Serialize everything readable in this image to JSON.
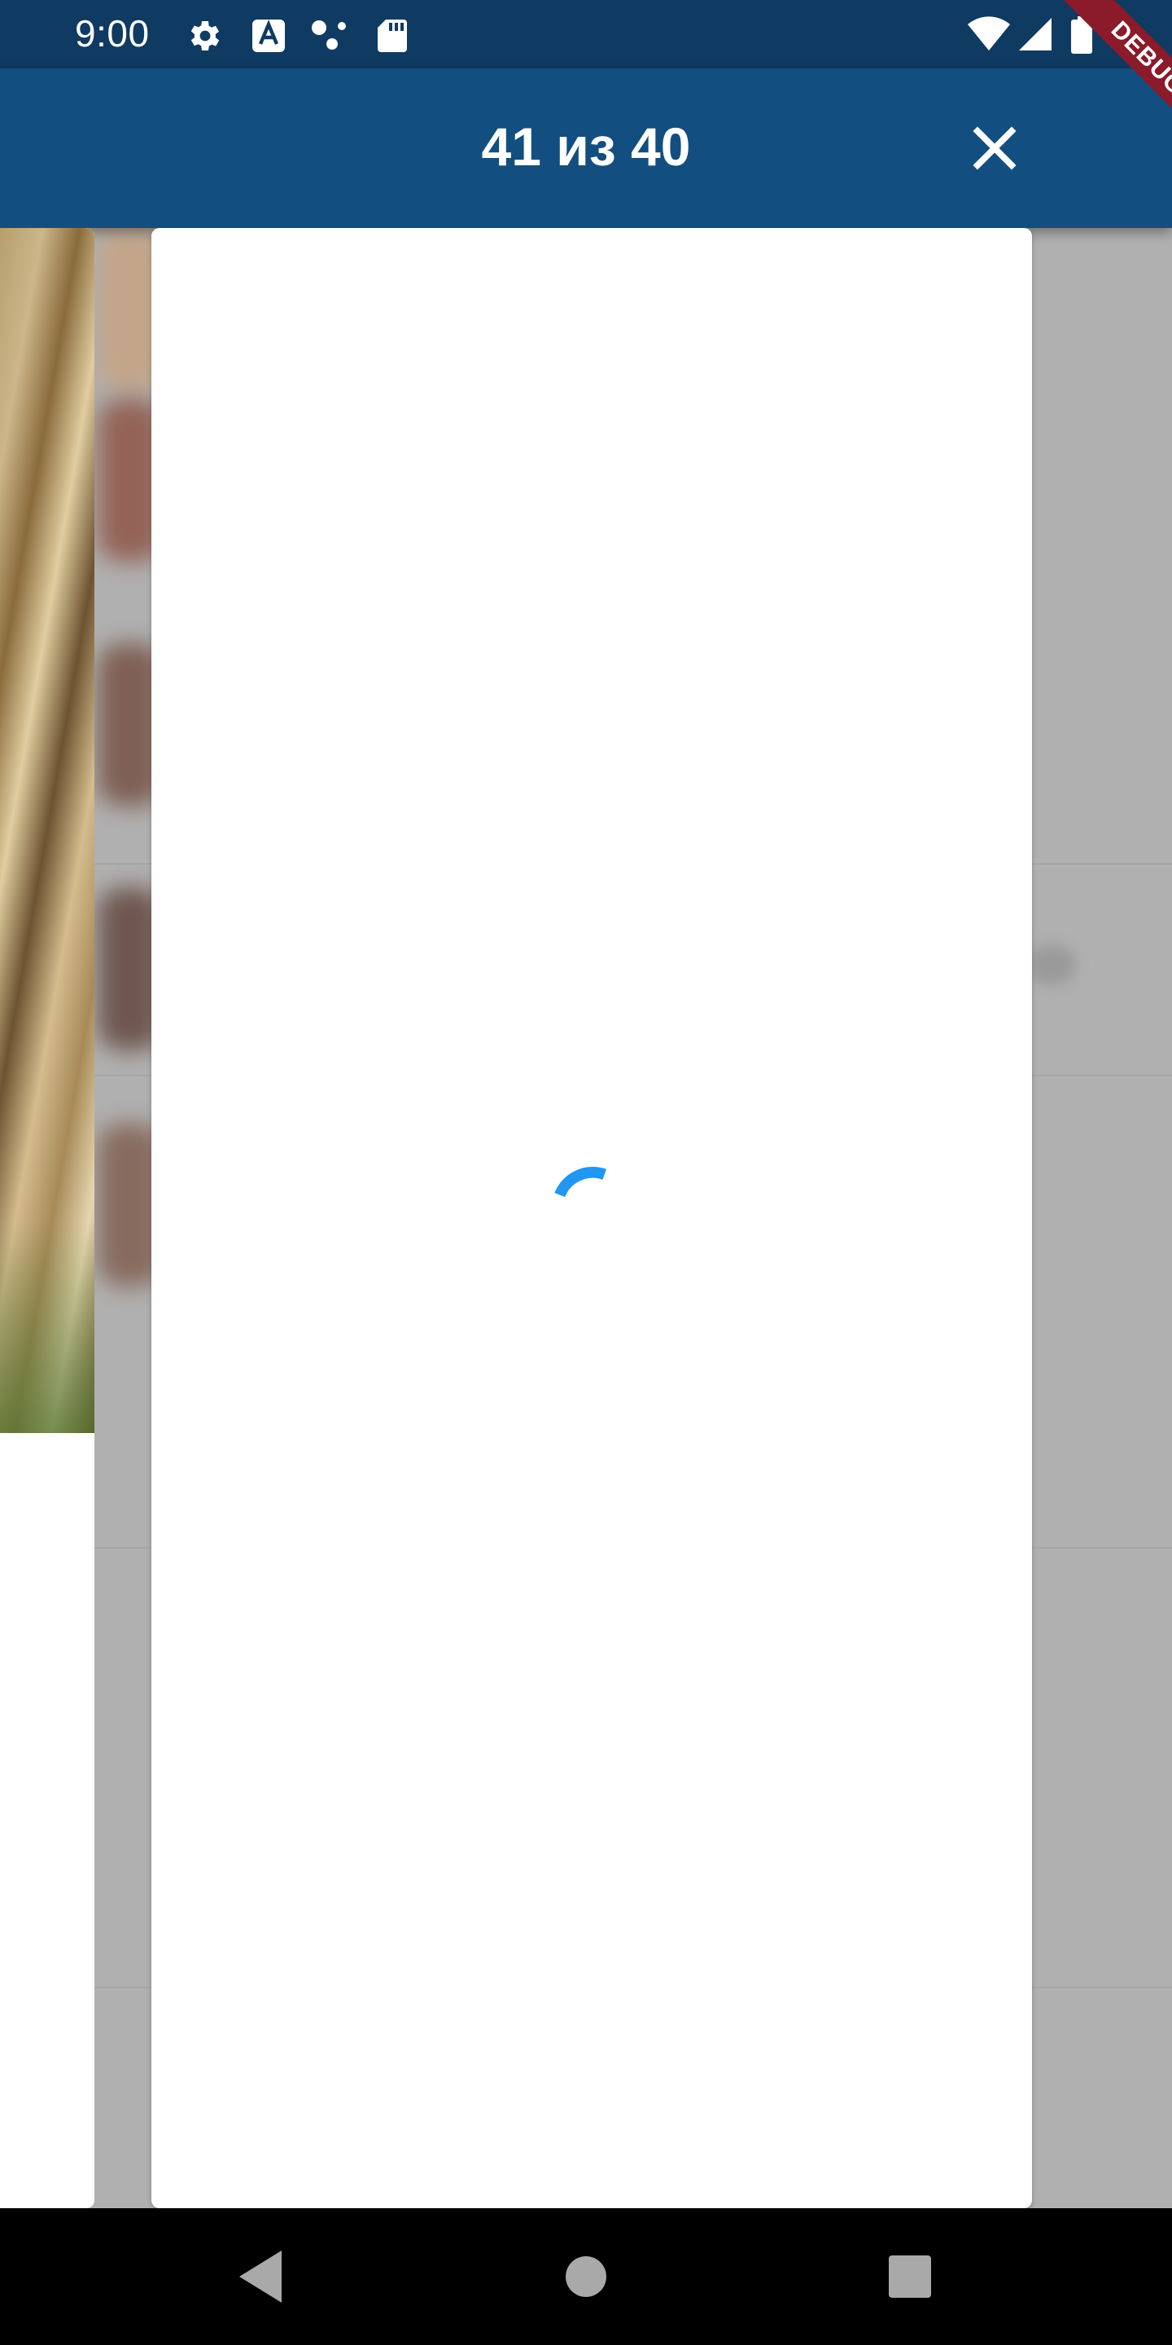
{
  "status_bar": {
    "time": "9:00",
    "left_icons": [
      "gear-icon",
      "font-a-icon",
      "dots-icon",
      "sd-card-icon"
    ],
    "right_icons": [
      "wifi-icon",
      "signal-icon",
      "battery-icon"
    ]
  },
  "app_bar": {
    "title": "41 из 40",
    "close_icon": "close-icon"
  },
  "debug_banner": "DEBUG",
  "viewer": {
    "state": "loading",
    "spinner_color": "#2196f3"
  },
  "nav_bar": {
    "buttons": [
      "back-icon",
      "home-icon",
      "recents-icon"
    ]
  },
  "colors": {
    "status_bar": "#0f3a62",
    "app_bar": "#134e80",
    "scrim": "#ababab",
    "accent": "#2196f3",
    "debug_ribbon": "#8b1a2b"
  }
}
